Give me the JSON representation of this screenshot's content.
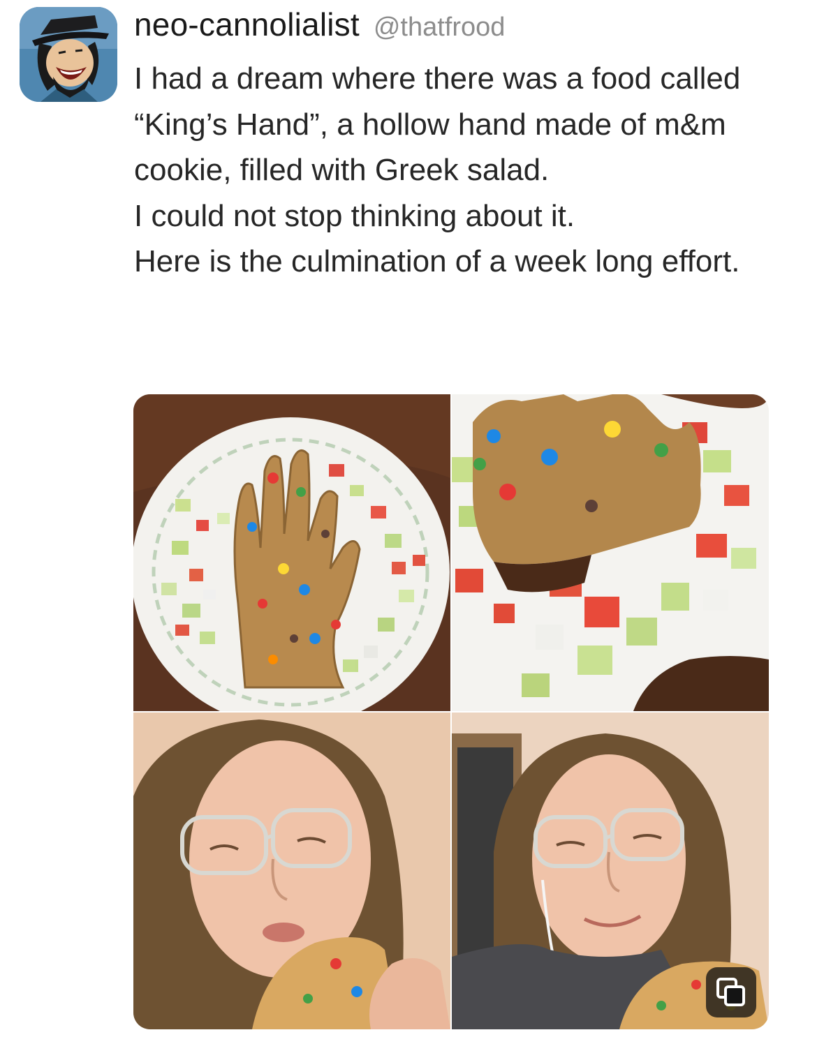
{
  "tweet": {
    "author": {
      "display_name": "neo-cannolialist",
      "handle": "@thatfrood"
    },
    "paragraphs": [
      "I had a dream where there was a food called “King’s Hand”, a hollow hand made of m&m cookie, filled with Greek salad.",
      "I could not stop thinking about it.",
      "Here is the culmination of a week long effort."
    ],
    "media_count": 4
  },
  "icons": {
    "avatar": "cartoon-avatar",
    "copy": "copy-icon"
  },
  "colors": {
    "background": "#ffffff",
    "text": "#262626",
    "handle": "#8c8c8c"
  }
}
